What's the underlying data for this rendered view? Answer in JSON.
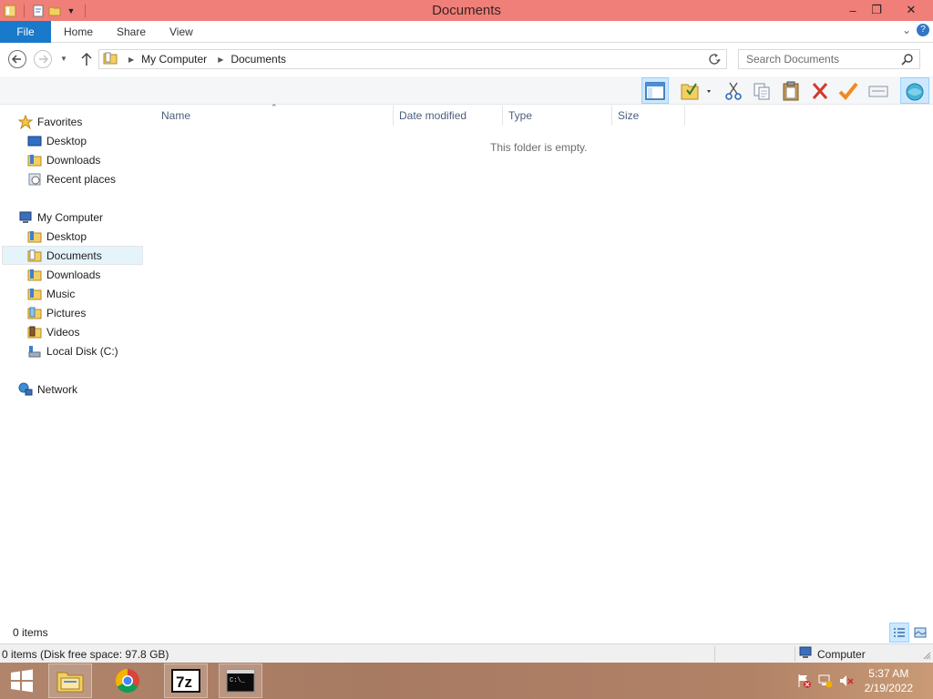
{
  "window": {
    "title": "Documents",
    "controls": {
      "minimize": "–",
      "restore": "❐",
      "close": "✕"
    },
    "titlebar_color": "#ef7f78"
  },
  "ribbon": {
    "tabs": [
      {
        "label": "File"
      },
      {
        "label": "Home"
      },
      {
        "label": "Share"
      },
      {
        "label": "View"
      }
    ],
    "accent": "#1979ca"
  },
  "address": {
    "crumbs": [
      "My Computer",
      "Documents"
    ],
    "search_placeholder": "Search Documents"
  },
  "toolbar": {
    "icons": [
      "preview-pane-icon",
      "properties-icon",
      "cut-icon",
      "copy-icon",
      "paste-icon",
      "delete-icon",
      "checkmark-icon",
      "rename-icon",
      "shell-icon"
    ]
  },
  "nav": {
    "favorites": {
      "label": "Favorites",
      "items": [
        "Desktop",
        "Downloads",
        "Recent places"
      ]
    },
    "computer": {
      "label": "My Computer",
      "items": [
        "Desktop",
        "Documents",
        "Downloads",
        "Music",
        "Pictures",
        "Videos",
        "Local Disk (C:)"
      ],
      "selected": "Documents"
    },
    "network": {
      "label": "Network"
    }
  },
  "content": {
    "columns": [
      "Name",
      "Date modified",
      "Type",
      "Size"
    ],
    "empty_message": "This folder is empty."
  },
  "countbar": {
    "items": "0 items"
  },
  "statusbar": {
    "left": "0 items (Disk free space: 97.8 GB)",
    "zone": "Computer"
  },
  "taskbar": {
    "apps": [
      "file-explorer-icon",
      "chrome-icon",
      "7zip-icon",
      "cmd-icon"
    ],
    "clock": {
      "time": "5:37 AM",
      "date": "2/19/2022"
    }
  }
}
